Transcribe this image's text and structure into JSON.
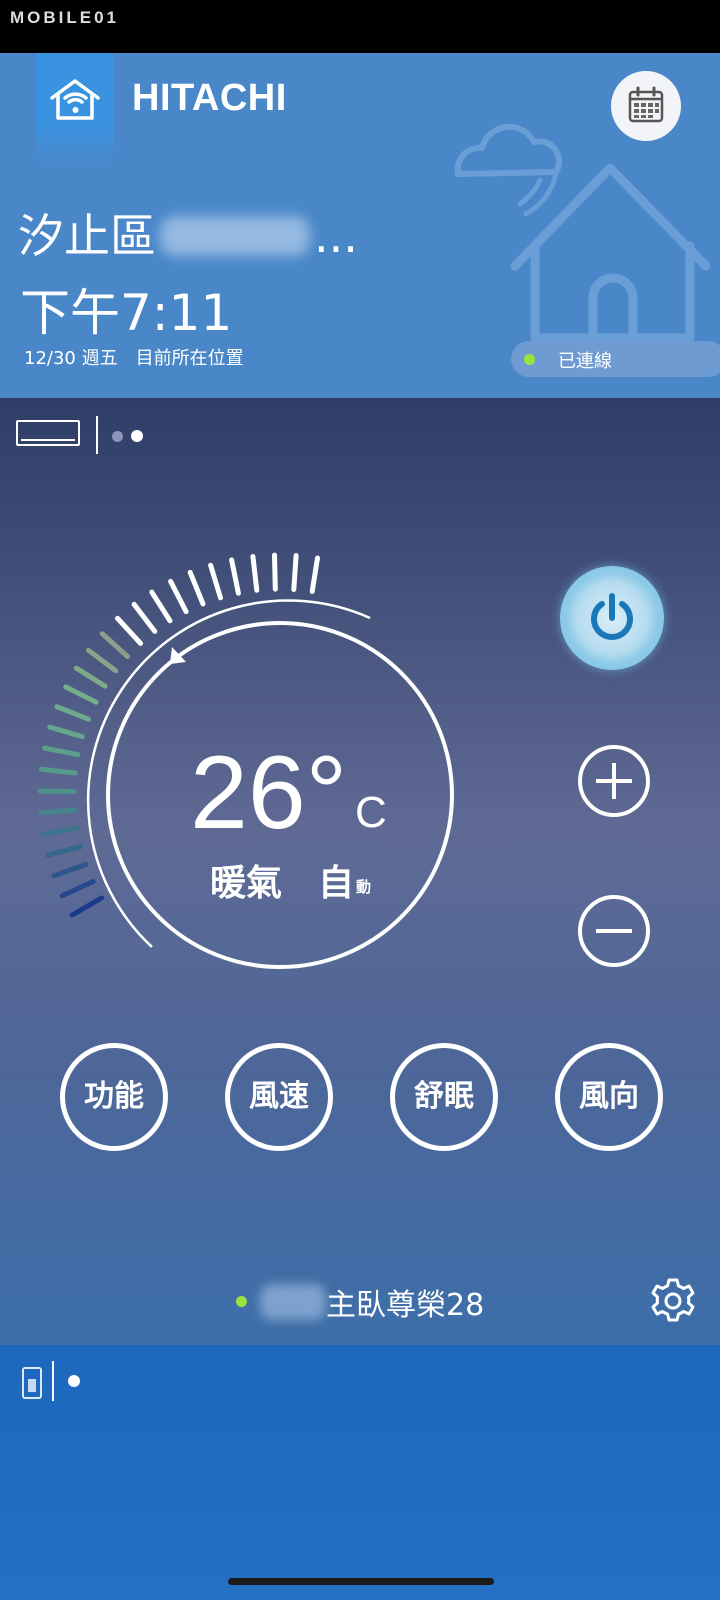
{
  "watermark": "MOBILE01",
  "header": {
    "brand": "HITACHI",
    "location": "汐止區",
    "location_ellipsis": "...",
    "time": "下午7:11",
    "date": "12/30 週五",
    "location_note": "目前所在位置",
    "connection_status": "已連線"
  },
  "control": {
    "temperature": "26°",
    "unit": "C",
    "mode": "暖氣",
    "fan": "自",
    "fan_sub": "動"
  },
  "functions": [
    {
      "label": "功能"
    },
    {
      "label": "風速"
    },
    {
      "label": "舒眠"
    },
    {
      "label": "風向"
    }
  ],
  "device": {
    "name": "主臥尊榮28"
  },
  "colors": {
    "header_bg": "#4a87c9",
    "accent_green": "#9be23c",
    "power_icon": "#1a78b8",
    "bottom_bg": "#1d68be"
  },
  "icons": {
    "logo": "wifi-house-icon",
    "calendar": "calendar-icon",
    "power": "power-icon",
    "plus": "plus-icon",
    "minus": "minus-icon",
    "settings": "gear-icon"
  }
}
